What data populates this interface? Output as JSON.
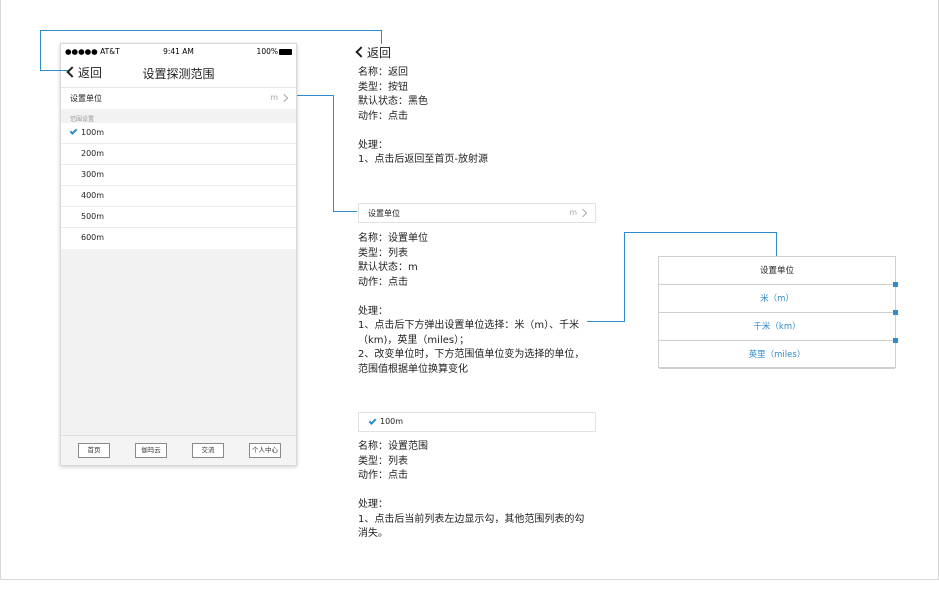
{
  "phone": {
    "status": {
      "carrier": "●●●●● AT&T",
      "time": "9:41 AM",
      "battery": "100%"
    },
    "nav": {
      "back_label": "返回",
      "title": "设置探测范围"
    },
    "unit_row": {
      "label": "设置单位",
      "value": "m"
    },
    "section_title": "范围设置",
    "ranges": [
      "100m",
      "200m",
      "300m",
      "400m",
      "500m",
      "600m"
    ],
    "selected_range": "100m",
    "tabs": [
      "首页",
      "伽玛云",
      "交流",
      "个人中心"
    ]
  },
  "annotations": {
    "back": {
      "label": "返回",
      "text": "名称：返回\n类型：按钮\n默认状态：黑色\n动作：点击\n\n处理：\n1、点击后返回至首页-放射源"
    },
    "unit": {
      "row_label": "设置单位",
      "row_value": "m",
      "text": "名称：设置单位\n类型：列表\n默认状态：m\n动作：点击\n\n处理：\n1、点击后下方弹出设置单位选择：米（m）、千米\n（km)，英里（miles）；\n2、改变单位时，下方范围值单位变为选择的单位，\n范围值根据单位换算变化"
    },
    "range": {
      "row_label": "100m",
      "text": "名称：设置范围\n类型：列表\n动作：点击\n\n处理：\n1、点击后当前列表左边显示勾，其他范围列表的勾\n消失。"
    }
  },
  "picker": {
    "title": "设置单位",
    "options": [
      "米（m）",
      "千米（km）",
      "英里（miles）"
    ]
  },
  "colors": {
    "accent": "#2d8ccf",
    "background": "#f2f2f2"
  }
}
